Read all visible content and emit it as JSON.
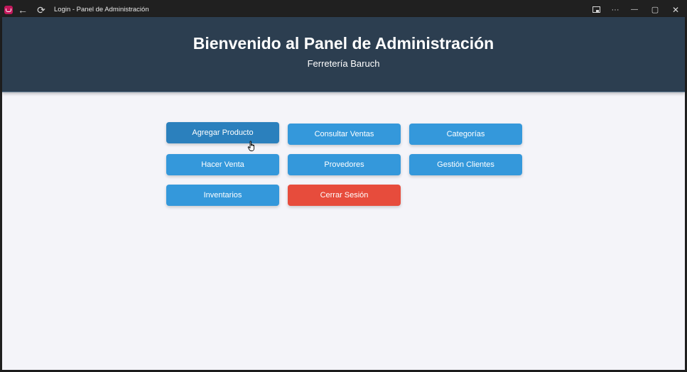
{
  "window": {
    "title": "Login - Panel de Administración"
  },
  "titlebar_icons": {
    "back": "←",
    "refresh": "⟳",
    "more": "···",
    "minimize": "—",
    "maximize": "▢",
    "close": "✕"
  },
  "header": {
    "title": "Bienvenido al Panel de Administración",
    "subtitle": "Ferretería Baruch",
    "background": "#2c3e50"
  },
  "buttons": {
    "agregar_producto": "Agregar Producto",
    "consultar_ventas": "Consultar Ventas",
    "categorias": "Categorías",
    "hacer_venta": "Hacer Venta",
    "provedores": "Provedores",
    "gestion_clientes": "Gestión Clientes",
    "inventarios": "Inventarios",
    "cerrar_sesion": "Cerrar Sesión"
  },
  "colors": {
    "primary_button": "#3498db",
    "hover_button": "#2b80bd",
    "danger_button": "#e74c3c",
    "page_background": "#f4f4f9"
  }
}
